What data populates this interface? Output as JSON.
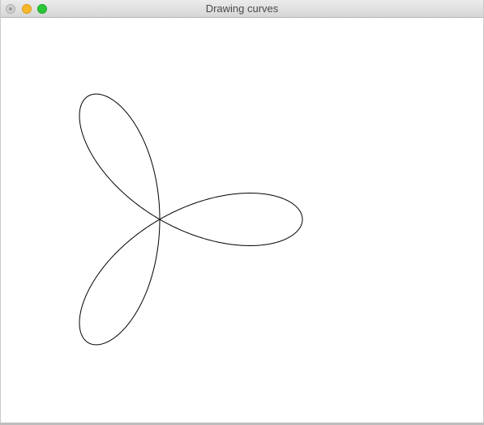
{
  "window": {
    "title": "Drawing curves"
  },
  "titlebar_buttons": {
    "close": "close-icon",
    "minimize": "minimize-icon",
    "maximize": "maximize-icon"
  },
  "colors": {
    "close": "#d0d0d0",
    "minimize": "#f6b72b",
    "maximize": "#2bc63a",
    "curve": "#000000",
    "background": "#ffffff"
  },
  "curve": {
    "type": "rose",
    "petals": 3
  }
}
